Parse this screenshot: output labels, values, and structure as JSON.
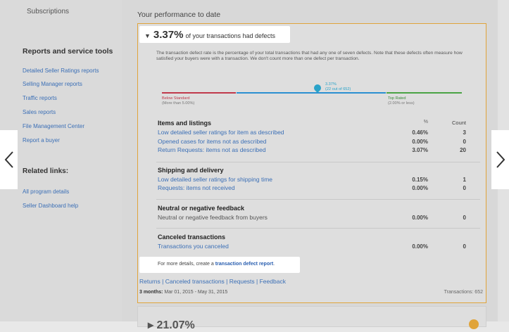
{
  "sidebar": {
    "top_item": "Subscriptions",
    "reports_title": "Reports and service tools",
    "reports_links": [
      "Detailed Seller Ratings reports",
      "Selling Manager reports",
      "Traffic reports",
      "Sales reports",
      "File Management Center",
      "Report a buyer"
    ],
    "related_title": "Related links:",
    "related_links": [
      "All program details",
      "Seller Dashboard help"
    ]
  },
  "main": {
    "performance_title": "Your performance to date",
    "card": {
      "headline_pct": "3.37%",
      "headline_text": "of your transactions had defects",
      "description": "The transaction defect rate is the percentage of your total transactions that had any one of seven defects. Note that these defects often measure how satisfied your buyers were with a transaction. We don't count more than one defect per transaction.",
      "marker": {
        "pct": "3.37%",
        "sub": "(22 out of 652)"
      },
      "below_standard": {
        "label": "Below Standard",
        "sub": "(More than 5.00%)"
      },
      "top_rated": {
        "label": "Top Rated",
        "sub": "(2.00% or less)"
      },
      "col_pct": "%",
      "col_count": "Count",
      "groups": [
        {
          "title": "Items and listings",
          "rows": [
            {
              "label": "Low detailed seller ratings for item as described",
              "pct": "0.46%",
              "count": "3"
            },
            {
              "label": "Opened cases for items not as described",
              "pct": "0.00%",
              "count": "0"
            },
            {
              "label": "Return Requests: items not as described",
              "pct": "3.07%",
              "count": "20"
            }
          ]
        },
        {
          "title": "Shipping and delivery",
          "rows": [
            {
              "label": "Low detailed seller ratings for shipping time",
              "pct": "0.15%",
              "count": "1"
            },
            {
              "label": "Requests: items not received",
              "pct": "0.00%",
              "count": "0"
            }
          ]
        },
        {
          "title": "Neutral or negative feedback",
          "rows": [
            {
              "label": "Neutral or negative feedback from buyers",
              "pct": "0.00%",
              "count": "0"
            }
          ]
        },
        {
          "title": "Canceled transactions",
          "rows": [
            {
              "label": "Transactions you canceled",
              "pct": "0.00%",
              "count": "0"
            }
          ]
        }
      ],
      "more_prefix": "For more details, create a ",
      "more_link": "transaction defect report",
      "more_suffix": ".",
      "footer_links": [
        "Returns",
        "Canceled transactions",
        "Requests",
        "Feedback"
      ],
      "period_label": "3 months:",
      "period_value": "Mar 01, 2015 - May 31, 2015",
      "transactions": "Transactions: 652"
    },
    "next_card_peek": "▸ 21.07%"
  },
  "colors": {
    "accent": "#e0a43a",
    "link": "#3b6fb6",
    "below_standard": "#c0394b",
    "average": "#2b8fd1",
    "top_rated": "#4aa344",
    "marker": "#2aa3c9"
  },
  "icons": {
    "prev": "chevron-left-icon",
    "next": "chevron-right-icon",
    "expand": "triangle-down-icon",
    "marker": "map-pin-icon"
  }
}
